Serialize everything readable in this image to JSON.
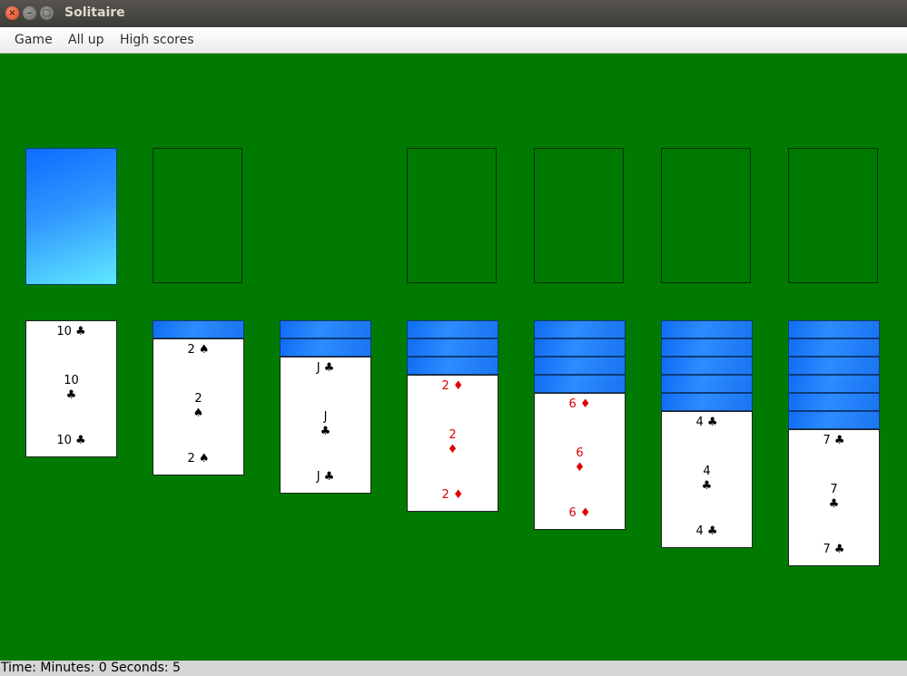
{
  "window": {
    "title": "Solitaire"
  },
  "menu": {
    "game": "Game",
    "all_up": "All up",
    "high_scores": "High scores"
  },
  "status": {
    "time_text": "Time: Minutes: 0 Seconds: 5"
  },
  "tableau": [
    {
      "face_down": 0,
      "rank": "10",
      "suit": "♣",
      "color": "black"
    },
    {
      "face_down": 1,
      "rank": "2",
      "suit": "♠",
      "color": "black"
    },
    {
      "face_down": 2,
      "rank": "J",
      "suit": "♣",
      "color": "black"
    },
    {
      "face_down": 3,
      "rank": "2",
      "suit": "♦",
      "color": "red"
    },
    {
      "face_down": 4,
      "rank": "6",
      "suit": "♦",
      "color": "red"
    },
    {
      "face_down": 5,
      "rank": "4",
      "suit": "♣",
      "color": "black"
    },
    {
      "face_down": 6,
      "rank": "7",
      "suit": "♣",
      "color": "black"
    }
  ]
}
